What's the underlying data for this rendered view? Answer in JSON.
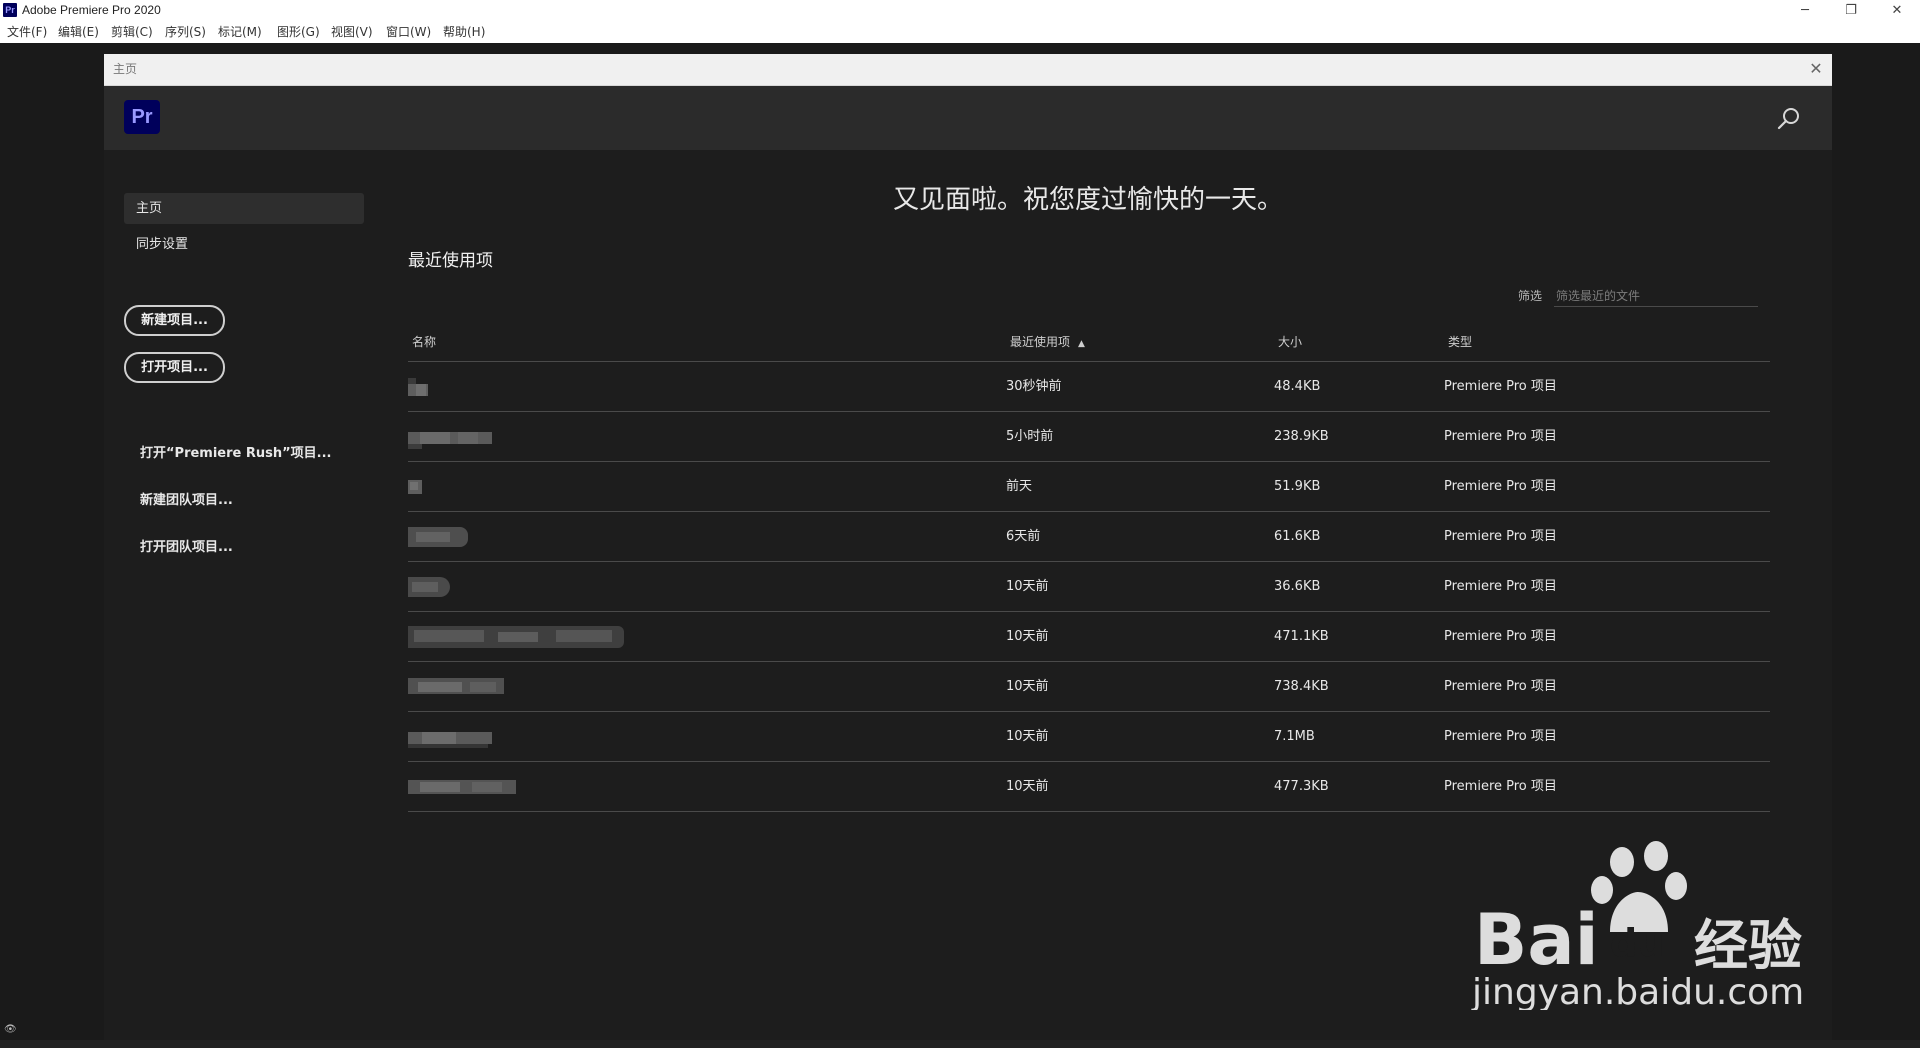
{
  "window": {
    "title": "Adobe Premiere Pro 2020",
    "app_icon_label": "Pr",
    "minimize_glyph": "─",
    "maximize_glyph": "❐",
    "close_glyph": "✕"
  },
  "menu": [
    {
      "label": "文件(F)"
    },
    {
      "label": "编辑(E)"
    },
    {
      "label": "剪辑(C)"
    },
    {
      "label": "序列(S)"
    },
    {
      "label": "标记(M)"
    },
    {
      "label": "图形(G)"
    },
    {
      "label": "视图(V)"
    },
    {
      "label": "窗口(W)"
    },
    {
      "label": "帮助(H)"
    }
  ],
  "dialog": {
    "title": "主页",
    "close_glyph": "✕",
    "logo_label": "Pr",
    "search_icon": "search-icon"
  },
  "sidebar": {
    "nav": [
      {
        "label": "主页",
        "active": true
      },
      {
        "label": "同步设置",
        "active": false
      }
    ],
    "buttons": [
      {
        "label": "新建项目..."
      },
      {
        "label": "打开项目..."
      }
    ],
    "links": [
      {
        "label": "打开“Premiere Rush”项目..."
      },
      {
        "label": "新建团队项目..."
      },
      {
        "label": "打开团队项目..."
      }
    ]
  },
  "main": {
    "greeting": "又见面啦。祝您度过愉快的一天。",
    "section_title": "最近使用项",
    "filter": {
      "label": "筛选",
      "placeholder": "筛选最近的文件"
    },
    "columns": {
      "name": "名称",
      "recent": "最近使用项",
      "recent_sort_icon": "sort-ascending-icon",
      "size": "大小",
      "type": "类型"
    },
    "rows": [
      {
        "recent": "30秒钟前",
        "size": "48.4KB",
        "type": "Premiere Pro 项目"
      },
      {
        "recent": "5小时前",
        "size": "238.9KB",
        "type": "Premiere Pro 项目"
      },
      {
        "recent": "前天",
        "size": "51.9KB",
        "type": "Premiere Pro 项目"
      },
      {
        "recent": "6天前",
        "size": "61.6KB",
        "type": "Premiere Pro 项目"
      },
      {
        "recent": "10天前",
        "size": "36.6KB",
        "type": "Premiere Pro 项目"
      },
      {
        "recent": "10天前",
        "size": "471.1KB",
        "type": "Premiere Pro 项目"
      },
      {
        "recent": "10天前",
        "size": "738.4KB",
        "type": "Premiere Pro 项目"
      },
      {
        "recent": "10天前",
        "size": "7.1MB",
        "type": "Premiere Pro 项目"
      },
      {
        "recent": "10天前",
        "size": "477.3KB",
        "type": "Premiere Pro 项目"
      }
    ]
  },
  "watermark": {
    "brand": "Bai",
    "brand_cn": "经验",
    "url": "jingyan.baidu.com"
  },
  "colors": {
    "premiere_logo_bg": "#00005b",
    "premiere_logo_fg": "#9999ff",
    "panel_bg": "#1d1d1d",
    "header_bg": "#2b2b2b",
    "divider": "#4a4a4a"
  }
}
